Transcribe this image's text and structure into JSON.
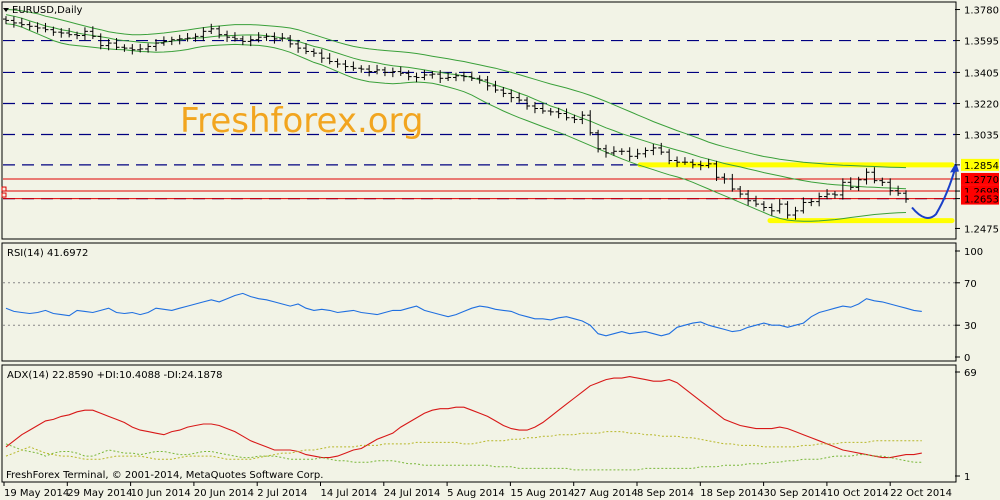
{
  "chart_data": [
    {
      "type": "candlestick",
      "title": "EURUSD,Daily",
      "watermark": "Freshforex.org",
      "ylim": [
        1.243,
        1.3801
      ],
      "y_ticks": [
        "1.3780",
        "1.3595",
        "1.3405",
        "1.3220",
        "1.3035",
        "1.2854",
        "1.2770",
        "1.2698",
        "1.2653",
        "1.2475"
      ],
      "hlines_dashed": [
        1.3595,
        1.3405,
        1.322,
        1.3035,
        1.2854,
        1.2653
      ],
      "hlines_red": [
        1.277,
        1.2698,
        1.2653
      ],
      "highlighted_levels": [
        1.2854,
        1.2522
      ],
      "price_label_marks": [
        {
          "text": "1.2854",
          "bg": "#ffff00"
        },
        {
          "text": "1.2770",
          "bg": "#ff0000"
        },
        {
          "text": "1.2698",
          "bg": "#ff0000"
        },
        {
          "text": "1.2653",
          "bg": "#ff0000"
        }
      ],
      "x_labels": [
        "19 May 2014",
        "29 May 2014",
        "10 Jun 2014",
        "20 Jun 2014",
        "2 Jul 2014",
        "14 Jul 2014",
        "24 Jul 2014",
        "5 Aug 2014",
        "15 Aug 2014",
        "27 Aug 2014",
        "8 Sep 2014",
        "18 Sep 2014",
        "30 Sep 2014",
        "10 Oct 2014",
        "22 Oct 2014"
      ],
      "close": [
        1.3715,
        1.37,
        1.369,
        1.368,
        1.367,
        1.366,
        1.3645,
        1.364,
        1.363,
        1.3625,
        1.365,
        1.362,
        1.3565,
        1.358,
        1.3555,
        1.355,
        1.354,
        1.3545,
        1.356,
        1.358,
        1.359,
        1.36,
        1.3605,
        1.361,
        1.362,
        1.365,
        1.3665,
        1.363,
        1.3615,
        1.3605,
        1.359,
        1.36,
        1.3615,
        1.362,
        1.3605,
        1.361,
        1.3575,
        1.355,
        1.353,
        1.352,
        1.349,
        1.347,
        1.3455,
        1.344,
        1.343,
        1.3425,
        1.341,
        1.342,
        1.3405,
        1.341,
        1.34,
        1.338,
        1.3375,
        1.339,
        1.3395,
        1.337,
        1.3375,
        1.3385,
        1.338,
        1.337,
        1.336,
        1.3325,
        1.33,
        1.328,
        1.3255,
        1.324,
        1.3205,
        1.319,
        1.3175,
        1.317,
        1.316,
        1.3135,
        1.3125,
        1.315,
        1.3045,
        1.295,
        1.2925,
        1.2935,
        1.2935,
        1.2905,
        1.292,
        1.294,
        1.2955,
        1.293,
        1.288,
        1.287,
        1.287,
        1.2855,
        1.285,
        1.286,
        1.278,
        1.277,
        1.271,
        1.268,
        1.264,
        1.262,
        1.26,
        1.258,
        1.262,
        1.2555,
        1.258,
        1.263,
        1.2635,
        1.2665,
        1.268,
        1.2675,
        1.275,
        1.272,
        1.2765,
        1.281,
        1.276,
        1.275,
        1.27,
        1.2685,
        1.265
      ],
      "series": [
        {
          "name": "MA",
          "values": [
            1.375,
            1.374,
            1.3728,
            1.3712,
            1.3698,
            1.3682,
            1.3672,
            1.366,
            1.3652,
            1.364,
            1.3632,
            1.3625,
            1.3618,
            1.361,
            1.36,
            1.3595,
            1.359,
            1.3585,
            1.3582,
            1.358,
            1.3585,
            1.3592,
            1.3598,
            1.3605,
            1.361,
            1.3612,
            1.3618,
            1.3622,
            1.3624,
            1.3626,
            1.3628,
            1.3629,
            1.3628,
            1.3624,
            1.3618,
            1.361,
            1.36,
            1.359,
            1.3575,
            1.356,
            1.355,
            1.3535,
            1.352,
            1.3505,
            1.349,
            1.3478,
            1.347,
            1.3462,
            1.3452,
            1.3445,
            1.344,
            1.3435,
            1.3428,
            1.342,
            1.3412,
            1.3405,
            1.3398,
            1.3392,
            1.3385,
            1.3375,
            1.336,
            1.3345,
            1.333,
            1.3315,
            1.33,
            1.3282,
            1.3265,
            1.3245,
            1.3225,
            1.3205,
            1.319,
            1.317,
            1.315,
            1.3132,
            1.3115,
            1.3095,
            1.3075,
            1.3058,
            1.304,
            1.3025,
            1.301,
            1.2995,
            1.298,
            1.2968,
            1.2955,
            1.2942,
            1.293,
            1.2915,
            1.29,
            1.2888,
            1.2875,
            1.2862,
            1.2852,
            1.2842,
            1.283,
            1.282,
            1.2808,
            1.2798,
            1.2788,
            1.2778,
            1.2768,
            1.276,
            1.2752,
            1.2746,
            1.274,
            1.2736,
            1.2732,
            1.2728,
            1.2725,
            1.2722,
            1.272,
            1.2718,
            1.2716,
            1.2714,
            1.2712
          ]
        },
        {
          "name": "Upper",
          "values": [
            1.378,
            1.3778,
            1.3772,
            1.3764,
            1.3755,
            1.374,
            1.373,
            1.3718,
            1.3706,
            1.3694,
            1.3682,
            1.367,
            1.366,
            1.3648,
            1.364,
            1.3634,
            1.363,
            1.363,
            1.3632,
            1.3636,
            1.364,
            1.3646,
            1.3652,
            1.3658,
            1.3665,
            1.3672,
            1.3678,
            1.3682,
            1.3686,
            1.369,
            1.369,
            1.369,
            1.3688,
            1.3684,
            1.368,
            1.3676,
            1.367,
            1.366,
            1.3645,
            1.363,
            1.3615,
            1.36,
            1.3585,
            1.3572,
            1.356,
            1.3552,
            1.3545,
            1.354,
            1.3536,
            1.3532,
            1.3528,
            1.3524,
            1.3518,
            1.351,
            1.3502,
            1.3494,
            1.3486,
            1.3478,
            1.347,
            1.346,
            1.345,
            1.344,
            1.343,
            1.3418,
            1.3405,
            1.3392,
            1.3378,
            1.3364,
            1.335,
            1.3336,
            1.3324,
            1.3312,
            1.3298,
            1.3284,
            1.3268,
            1.325,
            1.3232,
            1.3212,
            1.3192,
            1.3172,
            1.3152,
            1.3132,
            1.3112,
            1.3094,
            1.3076,
            1.3058,
            1.3042,
            1.3025,
            1.3008,
            1.299,
            1.2975,
            1.2962,
            1.295,
            1.2938,
            1.2926,
            1.2914,
            1.2904,
            1.2896,
            1.2888,
            1.2882,
            1.2876,
            1.287,
            1.2866,
            1.2862,
            1.2858,
            1.2855,
            1.2852,
            1.285,
            1.2848,
            1.2846,
            1.2844,
            1.2842,
            1.284,
            1.2839,
            1.2838
          ]
        },
        {
          "name": "Lower",
          "values": [
            1.3695,
            1.369,
            1.3675,
            1.3655,
            1.3635,
            1.3615,
            1.3595,
            1.358,
            1.357,
            1.3565,
            1.356,
            1.3555,
            1.355,
            1.3545,
            1.3542,
            1.354,
            1.3535,
            1.353,
            1.3528,
            1.3525,
            1.3527,
            1.353,
            1.3535,
            1.3542,
            1.3552,
            1.356,
            1.3565,
            1.3568,
            1.357,
            1.3572,
            1.357,
            1.3568,
            1.3566,
            1.356,
            1.3552,
            1.354,
            1.3525,
            1.3505,
            1.3485,
            1.3465,
            1.345,
            1.343,
            1.341,
            1.339,
            1.3372,
            1.336,
            1.335,
            1.3345,
            1.334,
            1.3338,
            1.334,
            1.3345,
            1.3348,
            1.3345,
            1.334,
            1.333,
            1.3318,
            1.3305,
            1.329,
            1.327,
            1.3245,
            1.322,
            1.3198,
            1.3175,
            1.3155,
            1.3135,
            1.3118,
            1.31,
            1.3082,
            1.3065,
            1.3048,
            1.303,
            1.301,
            1.299,
            1.297,
            1.295,
            1.293,
            1.291,
            1.289,
            1.2872,
            1.2855,
            1.284,
            1.2825,
            1.281,
            1.2795,
            1.2782,
            1.2768,
            1.275,
            1.273,
            1.271,
            1.269,
            1.267,
            1.265,
            1.263,
            1.261,
            1.259,
            1.257,
            1.255,
            1.2535,
            1.2525,
            1.252,
            1.2518,
            1.2518,
            1.252,
            1.2524,
            1.2528,
            1.2534,
            1.254,
            1.2546,
            1.2552,
            1.2558,
            1.2562,
            1.2566,
            1.2568,
            1.257
          ]
        }
      ]
    },
    {
      "type": "line",
      "title": "RSI(14) 41.6972",
      "ylim": [
        0,
        100
      ],
      "y_ticks": [
        "100",
        "70",
        "30",
        "0"
      ],
      "levels": [
        70,
        30
      ],
      "series": [
        {
          "name": "RSI(14)",
          "values": [
            46,
            43,
            42,
            41,
            42,
            44,
            41,
            40,
            39,
            44,
            43,
            42,
            44,
            46,
            42,
            41,
            42,
            40,
            42,
            46,
            45,
            44,
            46,
            48,
            50,
            52,
            54,
            52,
            55,
            58,
            60,
            57,
            55,
            54,
            52,
            50,
            48,
            50,
            46,
            44,
            45,
            44,
            42,
            43,
            44,
            42,
            41,
            40,
            42,
            44,
            44,
            46,
            48,
            44,
            42,
            40,
            38,
            40,
            43,
            46,
            48,
            47,
            45,
            44,
            43,
            40,
            38,
            36,
            36,
            35,
            37,
            38,
            36,
            34,
            30,
            22,
            20,
            22,
            24,
            22,
            23,
            24,
            22,
            20,
            22,
            28,
            30,
            32,
            33,
            30,
            28,
            26,
            24,
            25,
            28,
            30,
            32,
            30,
            30,
            28,
            30,
            32,
            38,
            42,
            44,
            46,
            48,
            47,
            50,
            55,
            53,
            52,
            50,
            48,
            46,
            44,
            43
          ]
        }
      ]
    },
    {
      "type": "line",
      "title": "ADX(14) 22.8590 +DI:10.4088 -DI:24.1878",
      "y_ticks": [
        "69",
        "1"
      ],
      "series": [
        {
          "name": "ADX(14)",
          "values": [
            20,
            24,
            28,
            31,
            34,
            37,
            38,
            40,
            41,
            43,
            44,
            44,
            42,
            40,
            38,
            36,
            33,
            31,
            30,
            29,
            28,
            30,
            31,
            33,
            34,
            35,
            35,
            34,
            32,
            30,
            27,
            24,
            22,
            20,
            18,
            18,
            18,
            17,
            15,
            14,
            13,
            13,
            14,
            16,
            18,
            19,
            22,
            25,
            27,
            29,
            33,
            36,
            39,
            42,
            44,
            45,
            45,
            46,
            46,
            44,
            42,
            40,
            37,
            34,
            32,
            31,
            31,
            33,
            36,
            40,
            44,
            48,
            52,
            56,
            60,
            62,
            64,
            65,
            65,
            66,
            65,
            64,
            63,
            63,
            64,
            62,
            58,
            54,
            50,
            46,
            42,
            38,
            36,
            34,
            33,
            32,
            32,
            32,
            33,
            32,
            30,
            28,
            26,
            24,
            22,
            20,
            18,
            17,
            16,
            15,
            14,
            13,
            13,
            14,
            15,
            15,
            16
          ]
        },
        {
          "name": "+DI",
          "values": [
            22,
            20,
            18,
            17,
            16,
            14,
            16,
            17,
            17,
            16,
            14,
            14,
            16,
            18,
            17,
            16,
            16,
            15,
            16,
            17,
            17,
            16,
            15,
            15,
            16,
            17,
            17,
            16,
            15,
            14,
            13,
            13,
            14,
            14,
            14,
            13,
            12,
            12,
            12,
            12,
            13,
            12,
            11,
            11,
            10,
            10,
            10,
            11,
            11,
            11,
            10,
            9,
            9,
            8,
            8,
            8,
            8,
            8,
            8,
            8,
            8,
            8,
            7,
            7,
            7,
            6,
            6,
            6,
            6,
            6,
            6,
            6,
            5,
            5,
            5,
            5,
            5,
            5,
            5,
            5,
            5,
            6,
            6,
            6,
            6,
            6,
            6,
            6,
            7,
            7,
            7,
            8,
            8,
            8,
            9,
            9,
            9,
            10,
            10,
            11,
            11,
            12,
            12,
            12,
            13,
            14,
            14,
            14,
            15,
            15,
            14,
            14,
            13,
            12,
            11,
            10,
            10
          ]
        },
        {
          "name": "-DI",
          "values": [
            14,
            16,
            18,
            20,
            18,
            16,
            15,
            14,
            14,
            13,
            12,
            12,
            12,
            13,
            14,
            14,
            14,
            14,
            13,
            12,
            12,
            12,
            13,
            14,
            14,
            14,
            14,
            13,
            12,
            12,
            12,
            12,
            13,
            14,
            15,
            16,
            16,
            17,
            18,
            18,
            19,
            20,
            20,
            20,
            20,
            21,
            21,
            21,
            22,
            22,
            22,
            22,
            23,
            23,
            23,
            23,
            23,
            23,
            22,
            22,
            23,
            24,
            24,
            24,
            25,
            25,
            26,
            26,
            27,
            27,
            28,
            28,
            28,
            29,
            29,
            29,
            30,
            30,
            30,
            29,
            29,
            28,
            28,
            27,
            27,
            27,
            26,
            26,
            25,
            24,
            23,
            22,
            22,
            21,
            21,
            21,
            20,
            20,
            20,
            20,
            20,
            21,
            21,
            22,
            22,
            22,
            23,
            23,
            23,
            23,
            24,
            24,
            24,
            24,
            24,
            24,
            24
          ]
        }
      ]
    }
  ],
  "footer": {
    "copyright": "FreshForex Terminal, © 2001-2014, MetaQuotes Software Corp."
  },
  "colors": {
    "bg": "#f2f3e6",
    "frame": "#000000",
    "grid_dash": "#000080",
    "ma": "#3aa03a",
    "rsi": "#1f6fe0",
    "adx": "#d81818",
    "plus_di": "#7ab83a",
    "minus_di": "#b8b82a",
    "highlight": "#ffff00",
    "arrow": "#1a3fc8",
    "red_level": "#e00000"
  }
}
